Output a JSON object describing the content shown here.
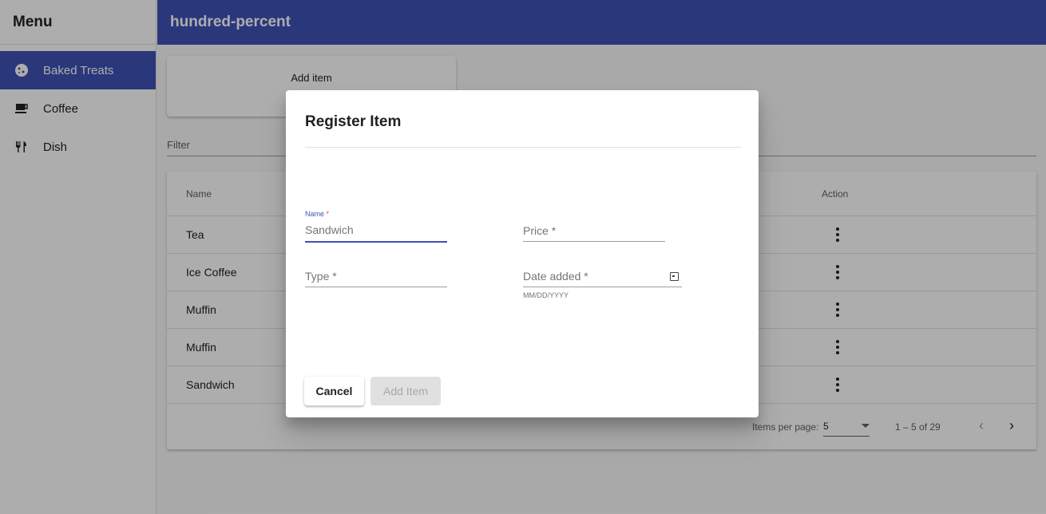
{
  "sidebar": {
    "title": "Menu",
    "items": [
      {
        "label": "Baked Treats",
        "icon": "cookie-icon",
        "active": true
      },
      {
        "label": "Coffee",
        "icon": "coffee-cup-icon",
        "active": false
      },
      {
        "label": "Dish",
        "icon": "fork-knife-icon",
        "active": false
      }
    ]
  },
  "topbar": {
    "title": "hundred-percent"
  },
  "main": {
    "add_card_label": "Add item",
    "filter_label": "Filter",
    "table": {
      "columns": [
        "Name",
        "Action"
      ],
      "rows": [
        {
          "name": "Tea"
        },
        {
          "name": "Ice Coffee"
        },
        {
          "name": "Muffin"
        },
        {
          "name": "Muffin"
        },
        {
          "name": "Sandwich"
        }
      ]
    },
    "paginator": {
      "items_per_page_label": "Items per page:",
      "page_size": "5",
      "range": "1 – 5 of 29"
    }
  },
  "dialog": {
    "title": "Register Item",
    "fields": {
      "name": {
        "label": "Name",
        "required_mark": "*",
        "placeholder": "Sandwich"
      },
      "price": {
        "label": "Price *"
      },
      "type": {
        "label": "Type *"
      },
      "date": {
        "label": "Date added *",
        "hint": "MM/DD/YYYY"
      }
    },
    "cancel_label": "Cancel",
    "add_label": "Add Item"
  },
  "colors": {
    "primary": "#3f51b5",
    "required": "#f44336",
    "overlay": "rgba(0,0,0,0.32)"
  }
}
